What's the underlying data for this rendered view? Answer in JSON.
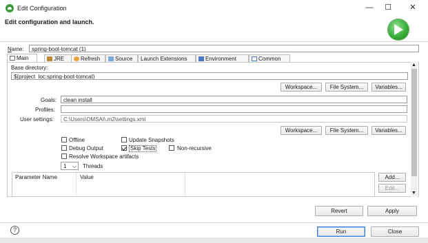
{
  "window": {
    "title": "Edit Configuration",
    "minimize": "—",
    "maximize": "☐",
    "close": "✕"
  },
  "header": {
    "title": "Edit configuration and launch."
  },
  "name": {
    "label_pre": "",
    "label_u": "N",
    "label_post": "ame:",
    "value": "spring-boot-tomcat (1)"
  },
  "tabs": [
    {
      "label": "Main",
      "icon": "main-tab-icon"
    },
    {
      "label": "JRE",
      "icon": "jre-icon"
    },
    {
      "label": "Refresh",
      "icon": "refresh-icon"
    },
    {
      "label": "Source",
      "icon": "source-icon"
    },
    {
      "label": "Launch Extensions",
      "icon": ""
    },
    {
      "label": "Environment",
      "icon": "environment-icon"
    },
    {
      "label": "Common",
      "icon": "common-icon"
    }
  ],
  "main": {
    "base_directory_label": "Base directory:",
    "base_directory_value": "${project_loc:spring-boot-tomcat}",
    "workspace_btn": "Workspace...",
    "filesystem_btn": "File System...",
    "variables_btn": "Variables...",
    "goals_label": "Goals:",
    "goals_value": "clean install",
    "profiles_label": "Profiles:",
    "profiles_value": "",
    "user_settings_label": "User settings:",
    "user_settings_value": "C:\\Users\\OMSAI\\.m2\\settings.xml",
    "offline": "Offline",
    "update_snapshots": "Update Snapshots",
    "debug_output": "Debug Output",
    "skip_tests": "Skip Tests",
    "non_recursive": "Non-recursive",
    "resolve_workspace": "Resolve Workspace artifacts",
    "threads_value": "1",
    "threads_label": "Threads",
    "table_headers": [
      "Parameter Name",
      "Value"
    ],
    "add_btn": "Add...",
    "edit_btn": "Edit..."
  },
  "footer": {
    "revert": "Revert",
    "apply": "Apply",
    "run": "Run",
    "close": "Close"
  },
  "colors": {
    "accent": "#3a7bd5",
    "run_green": "#34a934"
  }
}
